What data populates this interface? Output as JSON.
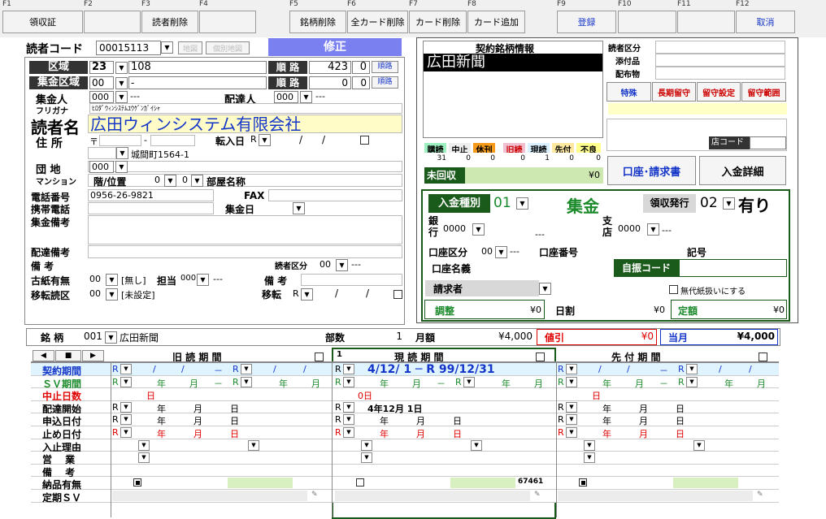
{
  "fkeys": {
    "f1": "F1",
    "f2": "F2",
    "f3": "F3",
    "f4": "F4",
    "f5": "F5",
    "f6": "F6",
    "f7": "F7",
    "f8": "F8",
    "f9": "F9",
    "f10": "F10",
    "f11": "F11",
    "f12": "F12"
  },
  "fbtns": {
    "b1": "領収証",
    "b3": "読者削除",
    "b5": "銘柄削除",
    "b6": "全カード削除",
    "b7": "カード削除",
    "b8": "カード追加",
    "b9": "登録",
    "b12": "取消"
  },
  "top": {
    "reader_code_label": "読者コード",
    "reader_code": "00015113",
    "map_btn": "地図",
    "detail_map_btn": "個別地図",
    "mode": "修正"
  },
  "area": {
    "label": "区域",
    "code": "23",
    "value": "108",
    "route_label": "順 路",
    "route_val": "423",
    "route_sub": "0",
    "route_btn": "順路"
  },
  "coll_area": {
    "label": "集金区域",
    "code": "00",
    "value": "-",
    "route_label": "順 路",
    "route_val": "0",
    "route_sub": "0",
    "route_btn": "順路"
  },
  "collector": {
    "label": "集金人",
    "code": "000",
    "value": "---",
    "deliv_label": "配達人",
    "deliv_code": "000",
    "deliv_value": "---"
  },
  "furigana": {
    "label": "フリガナ",
    "value": "ﾋﾛﾀﾞｳｨﾝｼｽﾃﾑﾕｳｹﾞﾝｶﾞｲｼｬ"
  },
  "name": {
    "label": "読者名",
    "value": "広田ウィンシステム有限会社"
  },
  "address": {
    "label": "住 所",
    "postal_mark": "〒",
    "postal_dash": "-",
    "movein_label": "転入日",
    "movein_r": "R",
    "movein_slash1": "/",
    "movein_slash2": "/",
    "town": "城間町1564-1"
  },
  "danchi": {
    "label": "団 地",
    "code": "000"
  },
  "mansion": {
    "label": "マンション",
    "floor_label": "階/位置",
    "floor": "0",
    "pos": "0",
    "room_label": "部屋名称"
  },
  "phone": {
    "label": "電話番号",
    "value": "0956-26-9821",
    "fax_label": "FAX"
  },
  "mobile": {
    "label": "携帯電話",
    "coll_day_label": "集金日"
  },
  "notes": {
    "coll_label": "集金備考",
    "deliv_label": "配達備考",
    "remark_label": "備 考",
    "reader_class_label": "読者区分",
    "reader_class_code": "00",
    "reader_class_value": "---"
  },
  "oldpaper": {
    "label": "古紙有無",
    "code": "00",
    "value": "[無し]",
    "staff_label": "担当",
    "staff_code": "000",
    "staff_value": "---",
    "remark_label": "備 考"
  },
  "transfer": {
    "label": "移転読区",
    "code": "00",
    "value": "[未設定]",
    "move_label": "移転",
    "move_r": "R",
    "s1": "/",
    "s2": "/"
  },
  "contract": {
    "title": "契約銘柄情報",
    "brand": "広田新聞",
    "headers": [
      "購読",
      "中止",
      "休刊",
      "旧読",
      "現読",
      "先付",
      "不良"
    ],
    "values": [
      "31",
      "0",
      "0",
      "0",
      "1",
      "0",
      "0"
    ],
    "unpaid_label": "未回収",
    "unpaid_value": "¥0"
  },
  "right_side": {
    "reader_class": "読者区分",
    "attach": "添付品",
    "distrib": "配布物",
    "special_btn": "特殊",
    "long_hold_btn": "長期留守",
    "hold_set_btn": "留守設定",
    "hold_range_btn": "留守範囲",
    "store_code": "店コード",
    "account_btn": "口座･請求書",
    "payment_btn": "入金詳細"
  },
  "payment": {
    "type_label": "入金種別",
    "type_code": "01",
    "type_value": "集金",
    "receipt_label": "領収発行",
    "receipt_code": "02",
    "receipt_value": "有り",
    "bank_label": "銀行",
    "bank_code": "0000",
    "bank_dash": "---",
    "branch_label": "支店",
    "branch_code": "0000",
    "branch_dash": "---",
    "acct_class_label": "口座区分",
    "acct_class_code": "00",
    "acct_class_value": "---",
    "acct_no_label": "口座番号",
    "symbol_label": "記号",
    "acct_name_label": "口座名義",
    "autocode_label": "自振コード",
    "billing_label": "請求者",
    "nopaper_label": "無代紙扱いにする",
    "adjust_label": "調整",
    "adjust_val": "¥0",
    "daily_label": "日割",
    "daily_val": "¥0",
    "fixed_label": "定額",
    "fixed_val": "¥0"
  },
  "brand_row": {
    "label": "銘 柄",
    "code": "001",
    "value": "広田新聞",
    "qty_label": "部数",
    "qty": "1",
    "monthly_label": "月額",
    "monthly": "¥4,000",
    "discount_label": "値引",
    "discount": "¥0",
    "current_label": "当月",
    "current": "¥4,000"
  },
  "period": {
    "old": "旧 読 期 間",
    "current": "現 読 期 間",
    "future": "先 付 期 間",
    "cur_idx": "1",
    "nav_prev": "◀",
    "nav_stop": "■",
    "nav_next": "▶"
  },
  "rows": [
    "契約期間",
    "ＳＶ期間",
    "中止日数",
    "配達開始",
    "申込日付",
    "止め日付",
    "入止理由",
    "営　 業",
    "備　 考",
    "納品有無",
    "定期ＳＶ"
  ],
  "cells": {
    "r": "R",
    "slash": "/",
    "dash": "－",
    "year": "年",
    "month": "月",
    "day": "日",
    "o_day": "0日",
    "cur_contract": "4/12/ 1 ─ R 99/12/31",
    "cur_start": "4年12月 1日",
    "cur_num": "67461"
  }
}
